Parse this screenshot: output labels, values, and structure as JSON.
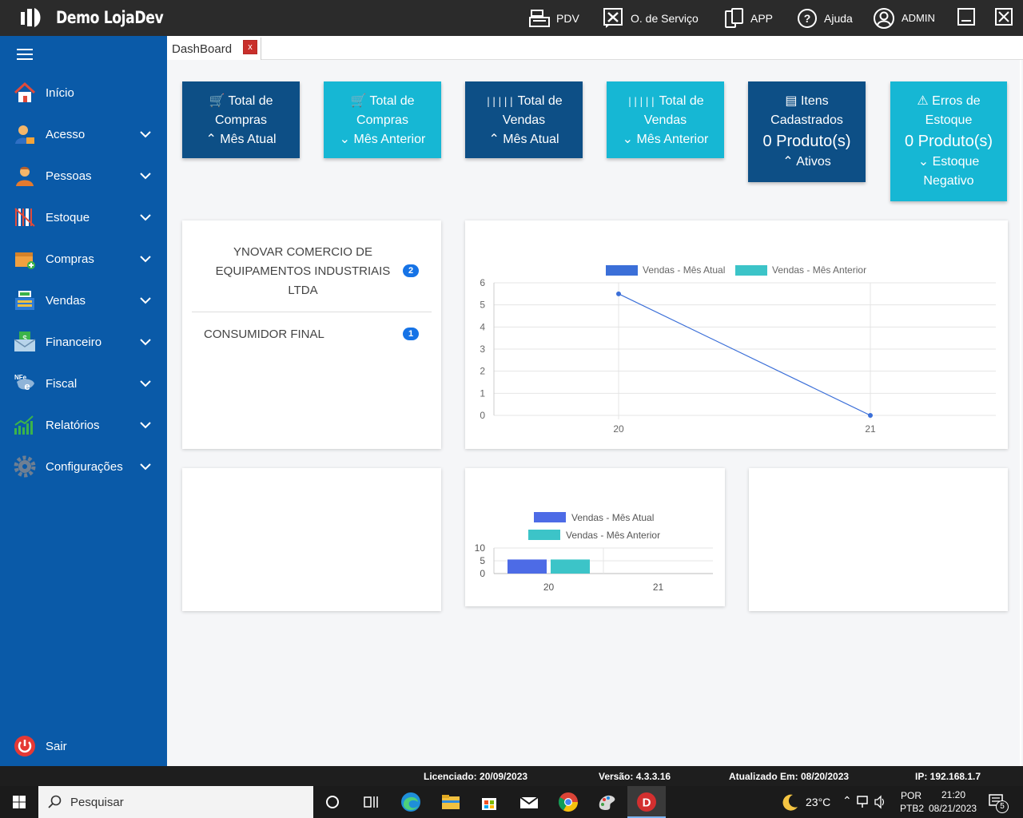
{
  "app": {
    "title": "Demo LojaDev"
  },
  "toolbar": {
    "pdv": "PDV",
    "os": "O. de Serviço",
    "app": "APP",
    "help": "Ajuda",
    "user": "ADMIN"
  },
  "sidebar": {
    "items": [
      {
        "label": "Início",
        "icon": "home-icon"
      },
      {
        "label": "Acesso",
        "icon": "user-access-icon"
      },
      {
        "label": "Pessoas",
        "icon": "people-icon"
      },
      {
        "label": "Estoque",
        "icon": "barcode-icon"
      },
      {
        "label": "Compras",
        "icon": "purchase-box-icon"
      },
      {
        "label": "Vendas",
        "icon": "cash-register-icon"
      },
      {
        "label": "Financeiro",
        "icon": "money-envelope-icon"
      },
      {
        "label": "Fiscal",
        "icon": "nfe-icon"
      },
      {
        "label": "Relatórios",
        "icon": "bar-chart-icon"
      },
      {
        "label": "Configurações",
        "icon": "gear-icon"
      }
    ],
    "exit": "Sair"
  },
  "tab": {
    "label": "DashBoard",
    "close": "x"
  },
  "cards": [
    {
      "l1": "Total de",
      "l2": "Compras",
      "l3": "Mês Atual",
      "style": "dark",
      "icon": "cart-icon",
      "arrow": "chevron-up-icon"
    },
    {
      "l1": "Total de",
      "l2": "Compras",
      "l3": "Mês Anterior",
      "style": "light",
      "icon": "cart-icon",
      "arrow": "chevron-down-icon"
    },
    {
      "l1": "Total de",
      "l2": "Vendas",
      "l3": "Mês Atual",
      "style": "dark",
      "icon": "barcode-icon",
      "arrow": "chevron-up-icon"
    },
    {
      "l1": "Total de",
      "l2": "Vendas",
      "l3": "Mês Anterior",
      "style": "light",
      "icon": "barcode-icon",
      "arrow": "chevron-down-icon"
    },
    {
      "l1": "Itens",
      "l2": "Cadastrados",
      "big": "0 Produto(s)",
      "l3": "Ativos",
      "style": "dark",
      "icon": "archive-icon",
      "arrow": "chevron-up-icon"
    },
    {
      "l1": "Erros de",
      "l2": "Estoque",
      "big": "0 Produto(s)",
      "l3": "Estoque",
      "l4": "Negativo",
      "style": "light",
      "icon": "warning-icon",
      "arrow": "chevron-down-icon"
    }
  ],
  "customers": [
    {
      "name_lines": [
        "YNOVAR COMERCIO DE",
        "EQUIPAMENTOS INDUSTRIAIS",
        "LTDA"
      ],
      "count": "2"
    },
    {
      "name_lines": [
        "CONSUMIDOR FINAL"
      ],
      "count": "1"
    }
  ],
  "chart_data": [
    {
      "type": "line",
      "legend": [
        "Vendas - Mês Atual",
        "Vendas - Mês Anterior"
      ],
      "legend_position": "top",
      "categories": [
        "20",
        "21"
      ],
      "series": [
        {
          "name": "Vendas - Mês Atual",
          "values": [
            5.5,
            0
          ],
          "color": "#3b6fd8"
        },
        {
          "name": "Vendas - Mês Anterior",
          "values": [],
          "color": "#3cc4c8"
        }
      ],
      "ylim": [
        0,
        6
      ],
      "yticks": [
        "0",
        "1",
        "2",
        "3",
        "4",
        "5",
        "6"
      ],
      "grid": true
    },
    {
      "type": "bar",
      "legend": [
        "Vendas - Mês Atual",
        "Vendas - Mês Anterior"
      ],
      "legend_position": "top",
      "categories": [
        "20",
        "21"
      ],
      "series": [
        {
          "name": "Vendas - Mês Atual",
          "values": [
            5.5,
            0
          ],
          "color": "#4d6be6"
        },
        {
          "name": "Vendas - Mês Anterior",
          "values": [
            5.5,
            0
          ],
          "color": "#3cc4c8"
        }
      ],
      "ylim": [
        0,
        10
      ],
      "yticks": [
        "0",
        "5",
        "10"
      ],
      "grid": true
    }
  ],
  "statusbar": {
    "license": "Licenciado: 20/09/2023",
    "version": "Versão: 4.3.3.16",
    "updated": "Atualizado Em: 08/20/2023",
    "ip": "IP: 192.168.1.7"
  },
  "taskbar": {
    "search": "Pesquisar",
    "weather": "23°C",
    "lang1": "POR",
    "lang2": "PTB2",
    "time": "21:20",
    "date": "08/21/2023",
    "notifications": "5"
  }
}
